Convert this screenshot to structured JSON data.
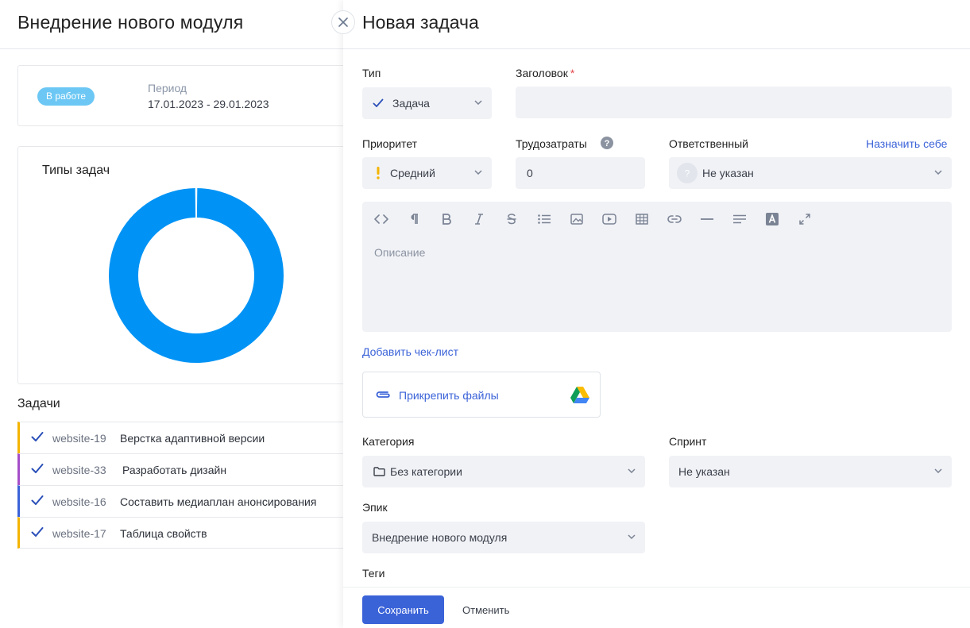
{
  "project": {
    "title": "Внедрение нового модуля",
    "status_badge": "В работе",
    "period_label": "Период",
    "period_value": "17.01.2023 - 29.01.2023",
    "chart_title": "Типы задач",
    "tasks_title": "Задачи",
    "tasks": [
      {
        "code": "website-19",
        "name": "Верстка адаптивной версии",
        "color": "#f4b400"
      },
      {
        "code": "website-33",
        "name": "Разработать дизайн",
        "color": "#a64fc9"
      },
      {
        "code": "website-16",
        "name": "Составить медиаплан анонсирования",
        "color": "#3b63d8"
      },
      {
        "code": "website-17",
        "name": "Таблица свойств",
        "color": "#f4b400"
      }
    ],
    "badge_color": "#6cc7f4"
  },
  "chart_data": {
    "type": "pie",
    "title": "Типы задач",
    "values": [
      100
    ],
    "colors": [
      "#0093f5"
    ],
    "donut": true
  },
  "form": {
    "title": "Новая задача",
    "type_label": "Тип",
    "type_value": "Задача",
    "heading_label": "Заголовок",
    "heading_required": "*",
    "heading_value": "",
    "priority_label": "Приоритет",
    "priority_value": "Средний",
    "effort_label": "Трудозатраты",
    "effort_value": "0",
    "assignee_label": "Ответственный",
    "assign_self": "Назначить себе",
    "assignee_value": "Не указан",
    "description_placeholder": "Описание",
    "add_checklist": "Добавить чек-лист",
    "attach_files": "Прикрепить файлы",
    "category_label": "Категория",
    "category_value": "Без категории",
    "sprint_label": "Спринт",
    "sprint_value": "Не указан",
    "epic_label": "Эпик",
    "epic_value": "Внедрение нового модуля",
    "tags_label": "Теги",
    "save": "Сохранить",
    "cancel": "Отменить",
    "toolbar": [
      "code-icon",
      "paragraph-icon",
      "bold-icon",
      "italic-icon",
      "strikethrough-icon",
      "bullet-list-icon",
      "image-icon",
      "video-icon",
      "table-icon",
      "link-icon",
      "horizontal-rule-icon",
      "align-icon",
      "text-color-icon",
      "fullscreen-icon"
    ],
    "accent_color": "#3b63d8"
  }
}
